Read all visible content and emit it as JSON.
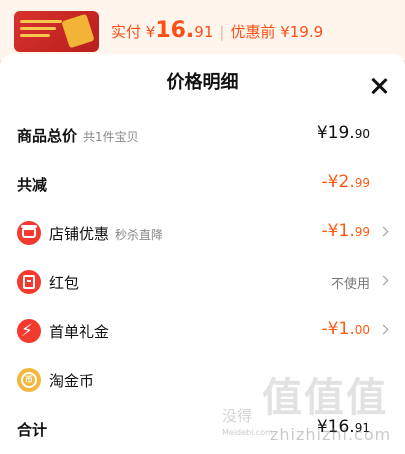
{
  "header": {
    "actual_label": "实付 ¥",
    "actual_price": "16.",
    "actual_cents": "91",
    "separator": "|",
    "before_discount": "优惠前 ¥19.9"
  },
  "sheet": {
    "title": "价格明细",
    "rows": [
      {
        "label": "商品总价",
        "sub": "共1件宝贝",
        "value": "¥19.",
        "cents": "90"
      },
      {
        "label": "共减",
        "value": "-¥2.",
        "cents": "99"
      },
      {
        "label": "店铺优惠",
        "sub": "秒杀直降",
        "value": "-¥1.",
        "cents": "99"
      },
      {
        "label": "红包",
        "value": "不使用"
      },
      {
        "label": "首单礼金",
        "value": "-¥1.",
        "cents": "00"
      },
      {
        "label": "淘金币"
      },
      {
        "label": "合计",
        "value": "¥16.",
        "cents": "91"
      }
    ]
  },
  "icons": {
    "shop": "shop-icon",
    "red_packet": "red-packet-icon",
    "first_order_gift": "lightning-icon",
    "taojinbi": "coin-icon",
    "close": "close-icon",
    "chevron": "chevron-right-icon"
  },
  "colors": {
    "accent_orange": "#ff5a14",
    "icon_red": "#f23a2f",
    "coin_gold": "#f4b73b"
  },
  "watermark": {
    "big": "值值值",
    "small": "没得",
    "domain": "zhizhizhi.com",
    "tiny": "Meidebi.com"
  }
}
